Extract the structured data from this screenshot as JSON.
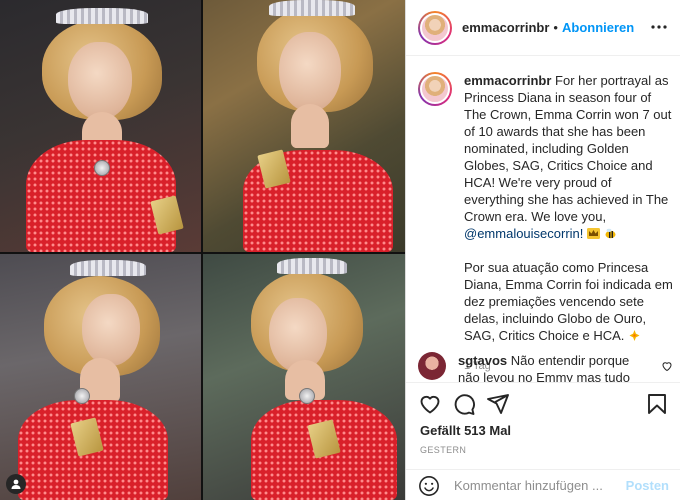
{
  "post": {
    "username": "emmacorrinbr",
    "follow_label": "Abonnieren",
    "dot": "•",
    "more_icon": "more-options-icon",
    "colors": {
      "accent": "#0095f6",
      "link": "#00376b",
      "muted": "#8e8e8e"
    }
  },
  "caption": {
    "username": "emmacorrinbr",
    "text_en": " For her portrayal as Princess Diana in season four of The Crown, Emma Corrin won 7 out of 10 awards that she has been nominated, including Golden Globes, SAG, Critics Choice and HCA! We're very proud of everything she has achieved in The Crown era. We love you, ",
    "mention": "@emmalouisecorrin!",
    "emoji_1": "crown-emoji",
    "emoji_2": "bee-emoji",
    "text_pt": "Por sua atuação como Princesa Diana, Emma Corrin foi indicada em dez premiações vencendo sete delas, incluindo Globo de Ouro, SAG, Critics Choice e HCA. ",
    "emoji_3": "sparkle-emoji",
    "time": "1 Tag"
  },
  "comment": {
    "username": "sgtavos",
    "text": " Não entendir porque não levou no Emmy mas tudo bem ela"
  },
  "actions": {
    "likes": "Gefällt 513 Mal",
    "date": "GESTERN",
    "icons": [
      "heart-icon",
      "comment-icon",
      "share-icon",
      "bookmark-icon"
    ]
  },
  "composer": {
    "placeholder": "Kommentar hinzufügen ...",
    "post_label": "Posten"
  }
}
